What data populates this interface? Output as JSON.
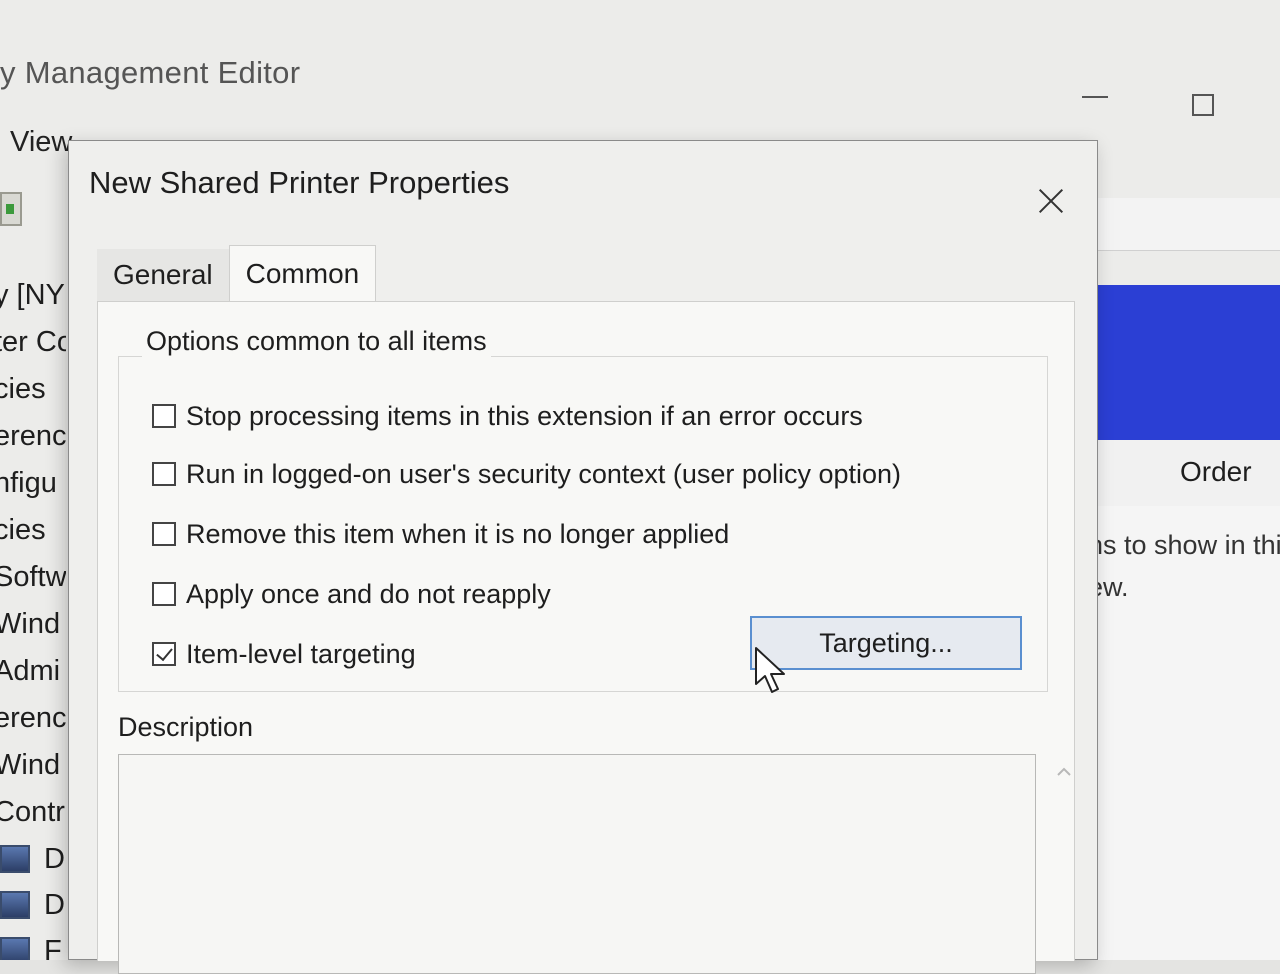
{
  "background_window": {
    "title": "y Management Editor",
    "menu_label": "View",
    "tree_items": [
      "y [NY",
      "ter Co",
      "cies",
      "erenc",
      "nfigu",
      "cies",
      "Softw",
      "Wind",
      "Admi",
      "erenc",
      "Wind",
      "Contr"
    ],
    "tree_icon_items": [
      "D",
      "D",
      "F"
    ],
    "column_header": "Order",
    "empty_message_line1": "ns to show in thi",
    "empty_message_line2": "ew."
  },
  "dialog": {
    "title": "New Shared Printer Properties",
    "tabs": [
      {
        "label": "General",
        "selected": false
      },
      {
        "label": "Common",
        "selected": true
      }
    ],
    "options_group_label": "Options common to all items",
    "options": [
      {
        "label": "Stop processing items in this extension if an error occurs",
        "checked": false
      },
      {
        "label": "Run in logged-on user's security context (user policy option)",
        "checked": false
      },
      {
        "label": "Remove this item when it is no longer applied",
        "checked": false
      },
      {
        "label": "Apply once and do not reapply",
        "checked": false
      },
      {
        "label": "Item-level targeting",
        "checked": true
      }
    ],
    "targeting_button_label": "Targeting...",
    "description_label": "Description",
    "description_value": ""
  },
  "colors": {
    "accent_blue": "#2b3fd4",
    "button_focus_border": "#5a8fd0"
  }
}
